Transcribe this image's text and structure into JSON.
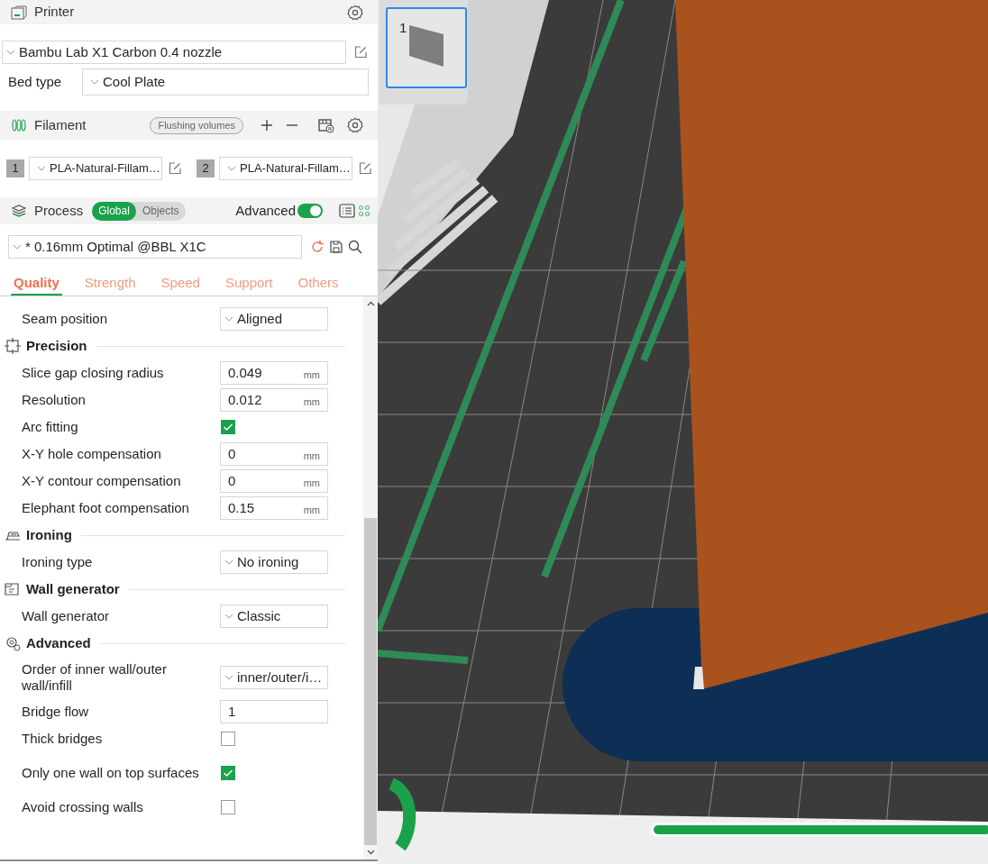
{
  "printer": {
    "title": "Printer",
    "preset": "Bambu Lab X1 Carbon 0.4 nozzle",
    "bed_type_label": "Bed type",
    "bed_type": "Cool Plate"
  },
  "filament": {
    "title": "Filament",
    "flushing_button": "Flushing volumes",
    "slots": [
      {
        "number": "1",
        "preset": "PLA-Natural-Fillam…"
      },
      {
        "number": "2",
        "preset": "PLA-Natural-Fillam…"
      }
    ]
  },
  "process": {
    "title": "Process",
    "scope": [
      {
        "label": "Global",
        "selected": true
      },
      {
        "label": "Objects",
        "selected": false
      }
    ],
    "advanced_label": "Advanced",
    "advanced_on": true,
    "preset": "* 0.16mm Optimal @BBL X1C"
  },
  "tabs": [
    {
      "label": "Quality",
      "selected": true
    },
    {
      "label": "Strength",
      "selected": false
    },
    {
      "label": "Speed",
      "selected": false
    },
    {
      "label": "Support",
      "selected": false
    },
    {
      "label": "Others",
      "selected": false
    }
  ],
  "settings": [
    {
      "kind": "dropdown",
      "label": "Seam position",
      "value": "Aligned"
    },
    {
      "kind": "group",
      "label": "Precision"
    },
    {
      "kind": "number",
      "label": "Slice gap closing radius",
      "value": "0.049",
      "unit": "mm"
    },
    {
      "kind": "number",
      "label": "Resolution",
      "value": "0.012",
      "unit": "mm"
    },
    {
      "kind": "checkbox",
      "label": "Arc fitting",
      "checked": true
    },
    {
      "kind": "number",
      "label": "X-Y hole compensation",
      "value": "0",
      "unit": "mm"
    },
    {
      "kind": "number",
      "label": "X-Y contour compensation",
      "value": "0",
      "unit": "mm"
    },
    {
      "kind": "number",
      "label": "Elephant foot compensation",
      "value": "0.15",
      "unit": "mm"
    },
    {
      "kind": "group",
      "label": "Ironing"
    },
    {
      "kind": "dropdown",
      "label": "Ironing type",
      "value": "No ironing"
    },
    {
      "kind": "group",
      "label": "Wall generator"
    },
    {
      "kind": "dropdown",
      "label": "Wall generator",
      "value": "Classic"
    },
    {
      "kind": "group",
      "label": "Advanced"
    },
    {
      "kind": "dropdown",
      "label": "Order of inner wall/outer wall/infill",
      "value": "inner/outer/i…"
    },
    {
      "kind": "number",
      "label": "Bridge flow",
      "value": "1"
    },
    {
      "kind": "checkbox",
      "label": "Thick bridges",
      "checked": false
    },
    {
      "kind": "checkbox",
      "label": "Only one wall on top surfaces",
      "checked": true
    },
    {
      "kind": "checkbox",
      "label": "Avoid crossing walls",
      "checked": false
    }
  ],
  "plates": [
    {
      "number": "1",
      "selected": true
    }
  ],
  "slicing_progress": {
    "level": 1
  }
}
